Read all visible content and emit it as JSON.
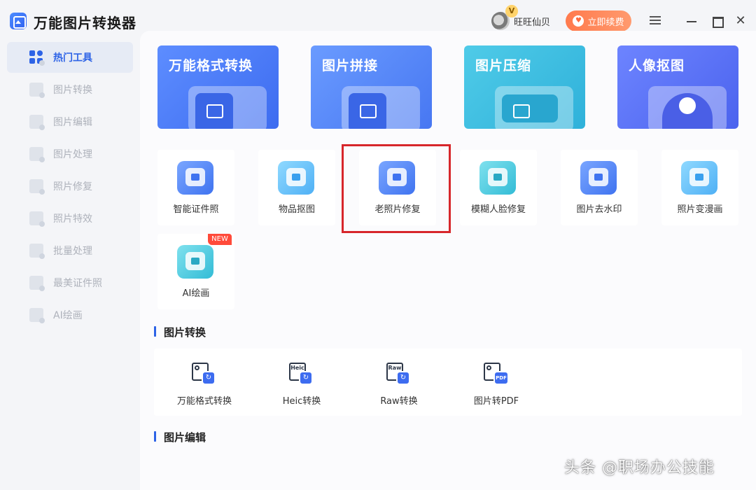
{
  "app": {
    "title": "万能图片转换器"
  },
  "user": {
    "name": "旺旺仙贝",
    "vip_badge": "V"
  },
  "header": {
    "renew_label": "立即续费"
  },
  "sidebar": {
    "items": [
      {
        "label": "热门工具",
        "active": true
      },
      {
        "label": "图片转换"
      },
      {
        "label": "图片编辑"
      },
      {
        "label": "图片处理"
      },
      {
        "label": "照片修复"
      },
      {
        "label": "照片特效"
      },
      {
        "label": "批量处理"
      },
      {
        "label": "最美证件照"
      },
      {
        "label": "AI绘画"
      }
    ]
  },
  "banners": [
    {
      "title": "万能格式转换"
    },
    {
      "title": "图片拼接"
    },
    {
      "title": "图片压缩"
    },
    {
      "title": "人像抠图"
    }
  ],
  "tools": [
    {
      "label": "智能证件照"
    },
    {
      "label": "物品抠图"
    },
    {
      "label": "老照片修复",
      "highlighted": true
    },
    {
      "label": "模糊人脸修复"
    },
    {
      "label": "图片去水印"
    },
    {
      "label": "照片变漫画"
    },
    {
      "label": "AI绘画",
      "tag": "NEW"
    }
  ],
  "sections": {
    "conversion": {
      "title": "图片转换",
      "items": [
        {
          "label": "万能格式转换",
          "icon_text": ""
        },
        {
          "label": "Heic转换",
          "icon_text": "Heic"
        },
        {
          "label": "Raw转换",
          "icon_text": "Raw"
        },
        {
          "label": "图片转PDF",
          "icon_text": "PDF"
        }
      ]
    },
    "editing": {
      "title": "图片编辑"
    }
  },
  "watermark": "头条 @职场办公技能",
  "colors": {
    "accent": "#2d63e6",
    "renew": "#ff8a5c",
    "highlight_border": "#d7262b",
    "new_tag": "#ff4a3a"
  }
}
